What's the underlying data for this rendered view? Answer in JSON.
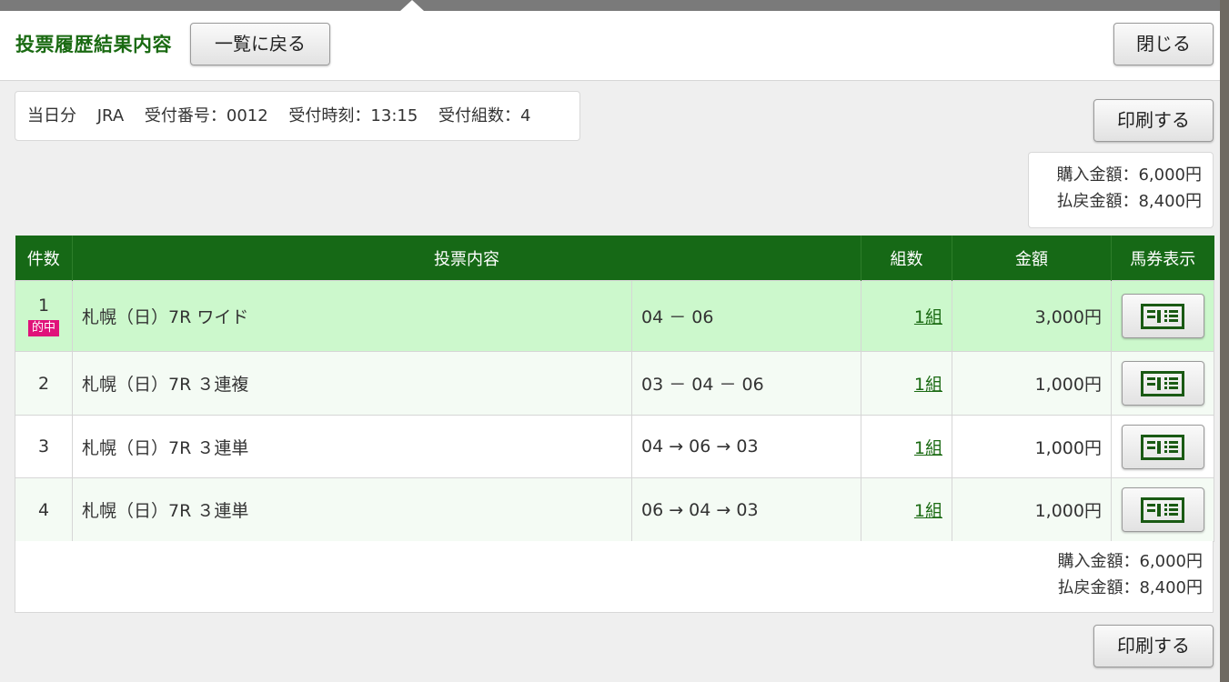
{
  "dialog": {
    "title": "投票履歴結果内容",
    "back_label": "一覧に戻る",
    "close_label": "閉じる",
    "print_label": "印刷する"
  },
  "info": {
    "day": "当日分",
    "org": "JRA",
    "receipt_number": "受付番号：0012",
    "receipt_time": "受付時刻：13:15",
    "receipt_count": "受付組数：4"
  },
  "summary": {
    "purchase": "購入金額：6,000円",
    "payout": "払戻金額：8,400円"
  },
  "table": {
    "headers": {
      "count": "件数",
      "content": "投票内容",
      "combos": "組数",
      "amount": "金額",
      "ticket": "馬券表示"
    },
    "rows": [
      {
        "no": "1",
        "badge": "的中",
        "race": "札幌（日）7R ワイド",
        "selection": "04 － 06",
        "combos": "1組",
        "amount": "3,000円"
      },
      {
        "no": "2",
        "race": "札幌（日）7R ３連複",
        "selection": "03 － 04 － 06",
        "combos": "1組",
        "amount": "1,000円"
      },
      {
        "no": "3",
        "race": "札幌（日）7R ３連単",
        "selection": "04 → 06 → 03",
        "combos": "1組",
        "amount": "1,000円"
      },
      {
        "no": "4",
        "race": "札幌（日）7R ３連単",
        "selection": "06 → 04 → 03",
        "combos": "1組",
        "amount": "1,000円"
      }
    ]
  },
  "colors": {
    "header_green": "#166916",
    "hit_row": "#ccf8cc",
    "hit_badge": "#e0127a",
    "title_green": "#1a6a12"
  },
  "icons": {
    "ticket": "ticket-icon"
  }
}
